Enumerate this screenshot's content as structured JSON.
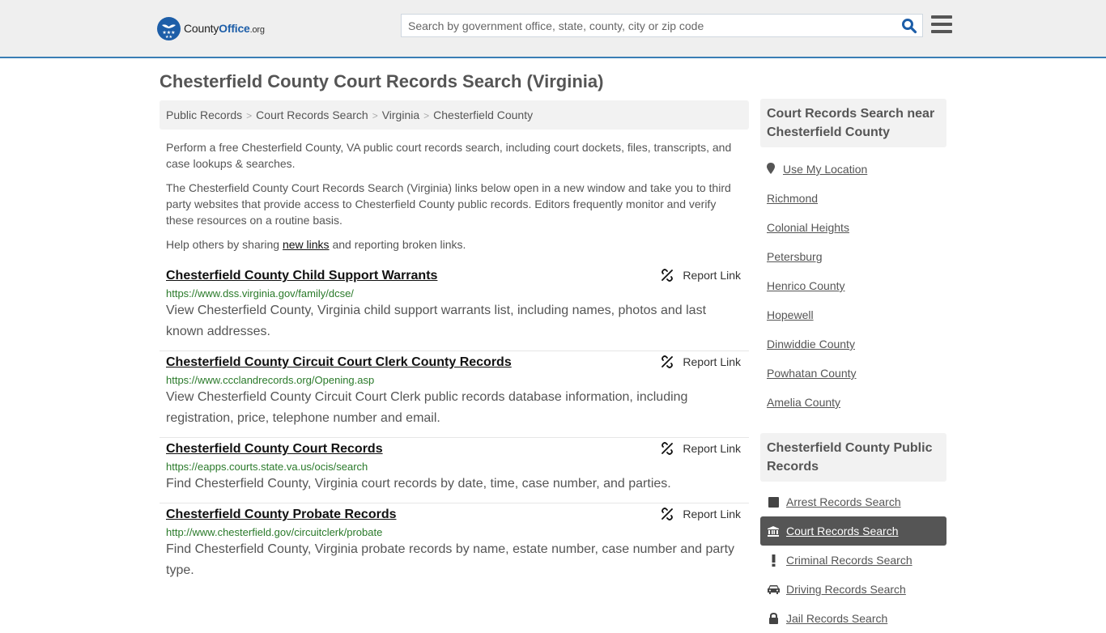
{
  "header": {
    "logo": {
      "brand_part1": "County",
      "brand_part2": "Office",
      "brand_suffix": ".org",
      "icon": "eagle-stars-badge-icon"
    },
    "search": {
      "placeholder": "Search by government office, state, county, city or zip code",
      "value": "",
      "icon": "search-icon"
    },
    "menu_icon": "hamburger-menu-icon"
  },
  "colors": {
    "brand_blue": "#1d5ea8",
    "header_border": "#3a7eb5",
    "url_green": "#2a7a2a",
    "active_nav_bg": "#555555"
  },
  "page_title": "Chesterfield County Court Records Search (Virginia)",
  "breadcrumb": [
    {
      "label": "Public Records"
    },
    {
      "label": "Court Records Search"
    },
    {
      "label": "Virginia"
    },
    {
      "label": "Chesterfield County"
    }
  ],
  "breadcrumb_separator": ">",
  "intro": {
    "p1": "Perform a free Chesterfield County, VA public court records search, including court dockets, files, transcripts, and case lookups & searches.",
    "p2": "The Chesterfield County Court Records Search (Virginia) links below open in a new window and take you to third party websites that provide access to Chesterfield County public records. Editors frequently monitor and verify these resources on a routine basis.",
    "p3_before": "Help others by sharing ",
    "p3_link": "new links",
    "p3_after": " and reporting broken links."
  },
  "report_label": "Report Link",
  "results": [
    {
      "title": "Chesterfield County Child Support Warrants",
      "url": "https://www.dss.virginia.gov/family/dcse/",
      "description": "View Chesterfield County, Virginia child support warrants list, including names, photos and last known addresses."
    },
    {
      "title": "Chesterfield County Circuit Court Clerk County Records",
      "url": "https://www.ccclandrecords.org/Opening.asp",
      "description": "View Chesterfield County Circuit Court Clerk public records database information, including registration, price, telephone number and email."
    },
    {
      "title": "Chesterfield County Court Records",
      "url": "https://eapps.courts.state.va.us/ocis/search",
      "description": "Find Chesterfield County, Virginia court records by date, time, case number, and parties."
    },
    {
      "title": "Chesterfield County Probate Records",
      "url": "http://www.chesterfield.gov/circuitclerk/probate",
      "description": "Find Chesterfield County, Virginia probate records by name, estate number, case number and party type."
    }
  ],
  "sidebar": {
    "nearby": {
      "heading": "Court Records Search near Chesterfield County",
      "use_location": "Use My Location",
      "places": [
        "Richmond",
        "Colonial Heights",
        "Petersburg",
        "Henrico County",
        "Hopewell",
        "Dinwiddie County",
        "Powhatan County",
        "Amelia County"
      ]
    },
    "public_records": {
      "heading": "Chesterfield County Public Records",
      "items": [
        {
          "label": "Arrest Records Search",
          "icon": "square-icon",
          "active": false
        },
        {
          "label": "Court Records Search",
          "icon": "courthouse-icon",
          "active": true
        },
        {
          "label": "Criminal Records Search",
          "icon": "exclamation-icon",
          "active": false
        },
        {
          "label": "Driving Records Search",
          "icon": "car-icon",
          "active": false
        },
        {
          "label": "Jail Records Search",
          "icon": "lock-icon",
          "active": false
        }
      ]
    }
  }
}
